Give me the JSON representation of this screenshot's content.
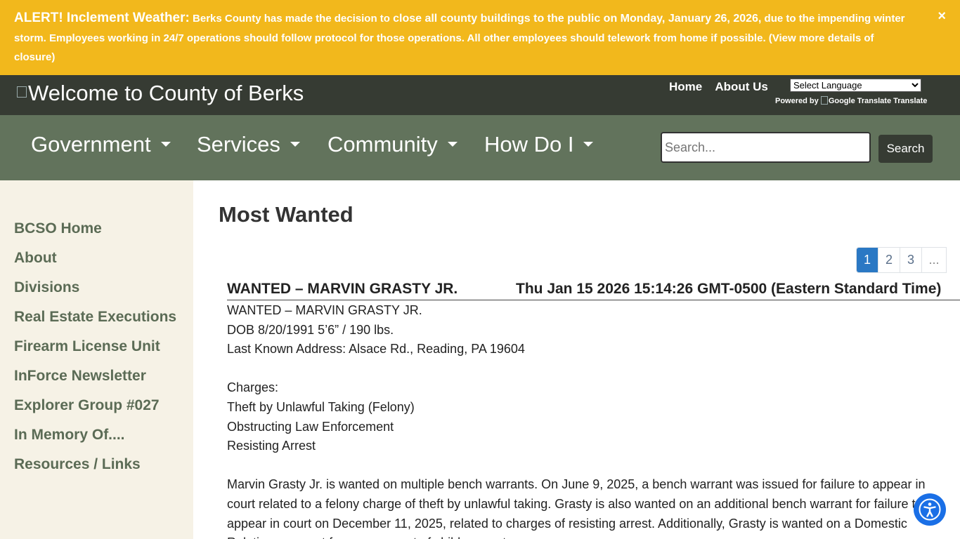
{
  "alert": {
    "title": "ALERT! Inclement Weather:",
    "part1": " Berks County has made the decision to ",
    "strong": "close all county buildings to the public on Monday, January 26, 2026,",
    "part2": " due to the impending winter storm. Employees working in 24/7 operations should follow protocol for those operations. All other employees should telework from home if possible. (View more details of closure)",
    "close_icon": "×"
  },
  "header": {
    "logo_alt": "Welcome to County of Berks",
    "links": [
      "Home",
      "About Us"
    ],
    "language_select": "Select Language",
    "powered_by": "Powered by",
    "google_alt": "Google Translate",
    "translate": "Translate"
  },
  "nav": {
    "items": [
      "Government",
      "Services",
      "Community",
      "How Do I"
    ],
    "search_placeholder": "Search...",
    "search_button": "Search"
  },
  "sidebar": {
    "items": [
      "BCSO Home",
      "About",
      "Divisions",
      "Real Estate Executions",
      "Firearm License Unit",
      "InForce Newsletter",
      "Explorer Group #027",
      "In Memory Of....",
      "Resources / Links"
    ]
  },
  "main": {
    "title": "Most Wanted",
    "pagination": [
      "1",
      "2",
      "3",
      "..."
    ],
    "active_page": "1",
    "post": {
      "title": "WANTED – MARVIN GRASTY JR.",
      "date": "Thu Jan 15 2026 15:14:26 GMT-0500 (Eastern Standard Time)",
      "lines": [
        "WANTED – MARVIN GRASTY JR.",
        "DOB 8/20/1991 5’6” / 190 lbs.",
        "Last Known Address: Alsace Rd., Reading, PA 19604"
      ],
      "charges_label": "Charges:",
      "charges": [
        "Theft by Unlawful Taking (Felony)",
        "Obstructing Law Enforcement",
        "Resisting Arrest"
      ],
      "description": "Marvin Grasty Jr. is wanted on multiple bench warrants. On June 9, 2025, a bench warrant was issued for failure to appear in court related to a felony charge of theft by unlawful taking. Grasty is also wanted on an additional bench warrant for failure to appear in court on December 11, 2025, related to charges of resisting arrest. Additionally, Grasty is wanted on a Domestic Relations warrant for nonpayment of child support."
    }
  },
  "accessibility_icon": "accessibility-person-icon"
}
